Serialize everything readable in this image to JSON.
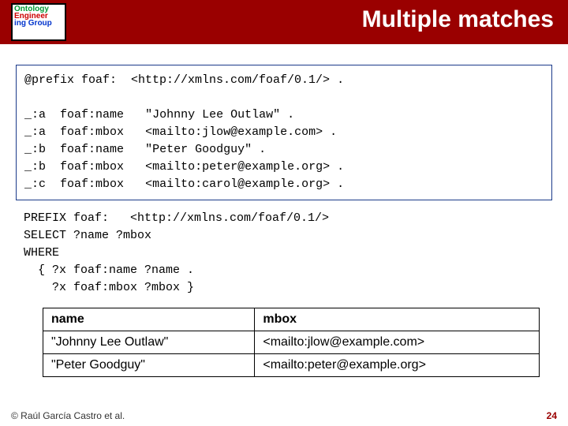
{
  "logo": {
    "l1": "Ontology",
    "l2": "Engineer",
    "l3": "ing Group",
    "alt": "Ontology Engineering Group"
  },
  "title": "Multiple matches",
  "code": {
    "line0": "@prefix foaf:  <http://xmlns.com/foaf/0.1/> .",
    "rows": [
      {
        "s": "_:a",
        "p": "foaf:name",
        "o": "\"Johnny Lee Outlaw\" ."
      },
      {
        "s": "_:a",
        "p": "foaf:mbox",
        "o": "<mailto:jlow@example.com> ."
      },
      {
        "s": "_:b",
        "p": "foaf:name",
        "o": "\"Peter Goodguy\" ."
      },
      {
        "s": "_:b",
        "p": "foaf:mbox",
        "o": "<mailto:peter@example.org> ."
      },
      {
        "s": "_:c",
        "p": "foaf:mbox",
        "o": "<mailto:carol@example.org> ."
      }
    ]
  },
  "query": {
    "l1": "PREFIX foaf:   <http://xmlns.com/foaf/0.1/>",
    "l2": "SELECT ?name ?mbox",
    "l3": "WHERE",
    "l4": "  { ?x foaf:name ?name .",
    "l5": "    ?x foaf:mbox ?mbox }"
  },
  "table": {
    "headers": {
      "c1": "name",
      "c2": "mbox"
    },
    "rows": [
      {
        "c1": "\"Johnny Lee Outlaw\"",
        "c2": "<mailto:jlow@example.com>"
      },
      {
        "c1": "\"Peter Goodguy\"",
        "c2": "<mailto:peter@example.org>"
      }
    ]
  },
  "footer": {
    "credit": "© Raúl García Castro et al.",
    "page": "24"
  }
}
